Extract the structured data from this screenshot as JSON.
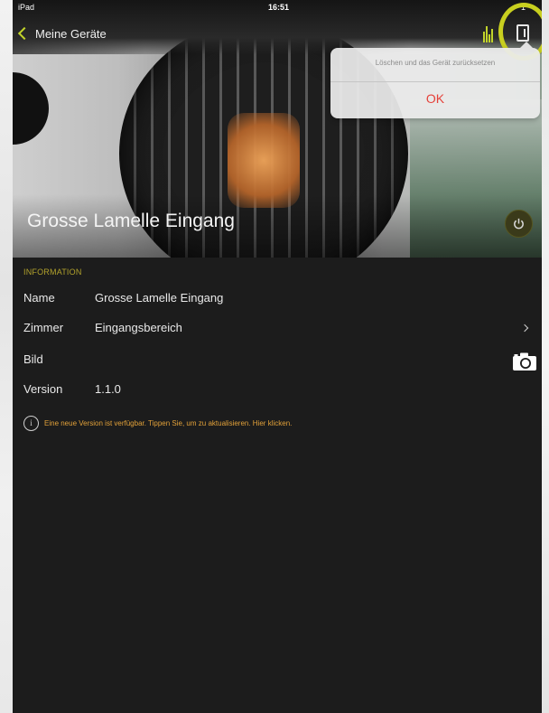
{
  "status_bar": {
    "carrier": "iPad",
    "time": "16:51",
    "right_text": "1"
  },
  "nav": {
    "back_label": "Meine Geräte"
  },
  "popover": {
    "message": "Löschen und das Gerät zurücksetzen",
    "ok_label": "OK"
  },
  "device": {
    "title": "Grosse Lamelle Eingang"
  },
  "info": {
    "section_title": "INFORMATION",
    "rows": [
      {
        "label": "Name",
        "value": "Grosse Lamelle Eingang"
      },
      {
        "label": "Zimmer",
        "value": "Eingangsbereich"
      },
      {
        "label": "Bild",
        "value": ""
      },
      {
        "label": "Version",
        "value": "1.1.0"
      }
    ],
    "update_note": "Eine neue Version ist verfügbar. Tippen Sie, um zu aktualisieren. Hier klicken."
  },
  "colors": {
    "accent": "#c2d42a",
    "highlight_ring": "#c8cf1f",
    "warning_text": "#e2a139",
    "destructive": "#e5413a"
  },
  "icons": {
    "back": "chevron-left-icon",
    "stats": "bars-icon",
    "device": "device-icon",
    "power": "power-icon",
    "camera": "camera-icon",
    "info": "info-icon",
    "disclosure": "chevron-right-icon"
  }
}
